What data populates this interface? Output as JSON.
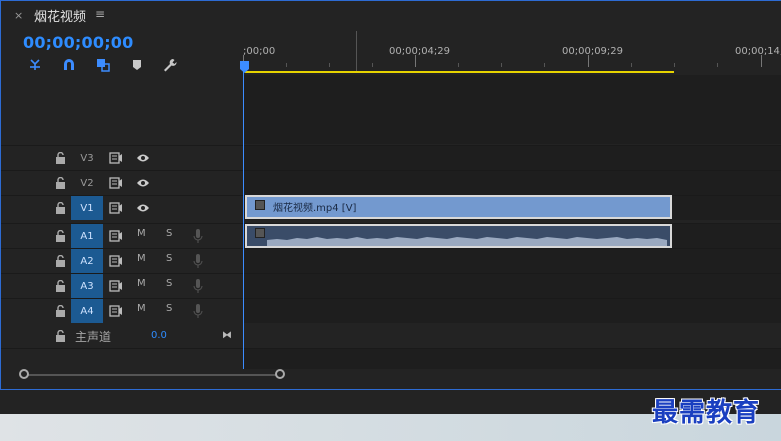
{
  "panel": {
    "close": "×",
    "title": "烟花视频",
    "menu": "≡",
    "timecode": "00;00;00;00"
  },
  "ruler": {
    "labels": [
      ";00;00",
      "00;00;04;29",
      "00;00;09;29",
      "00;00;14;"
    ]
  },
  "tracks": [
    {
      "name": "V3",
      "kind": "video"
    },
    {
      "name": "V2",
      "kind": "video"
    },
    {
      "name": "V1",
      "kind": "video",
      "targeted": true
    },
    {
      "name": "A1",
      "kind": "audio",
      "targeted": true
    },
    {
      "name": "A2",
      "kind": "audio",
      "targeted": true
    },
    {
      "name": "A3",
      "kind": "audio",
      "targeted": true
    },
    {
      "name": "A4",
      "kind": "audio",
      "targeted": true
    }
  ],
  "audio_buttons": {
    "mute": "M",
    "solo": "S"
  },
  "master": {
    "label": "主声道",
    "value": "0.0",
    "jump": "⧓"
  },
  "clips": {
    "video_label": "烟花视频.mp4 [V]"
  },
  "colors": {
    "accent": "#2e8cff",
    "target": "#1c5a92",
    "video_clip": "#7399cf",
    "audio_clip": "#3a4c68",
    "work_area": "#e6d300"
  },
  "watermark": "最需教育"
}
